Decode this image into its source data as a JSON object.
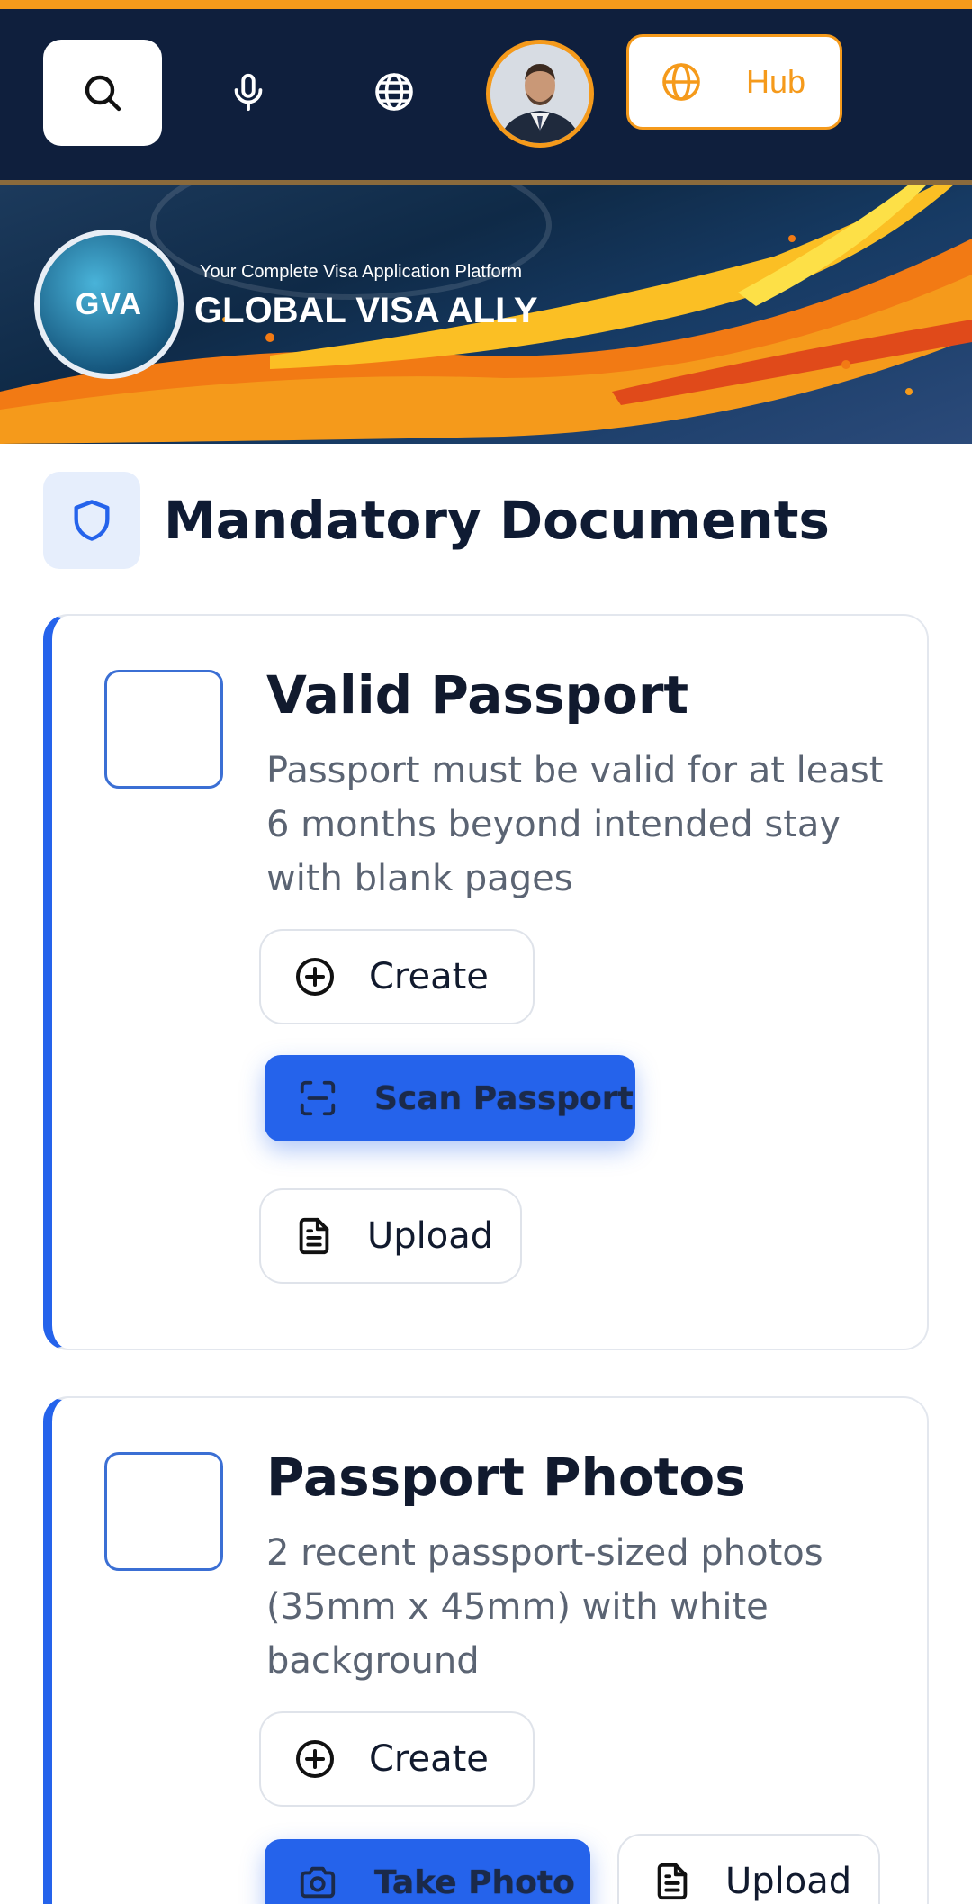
{
  "header": {
    "hub_label": "Hub",
    "accent_color": "#f59a1b",
    "bar_color": "#0f1f3d",
    "icons": [
      "search-icon",
      "microphone-icon",
      "globe-icon",
      "globe-icon"
    ]
  },
  "banner": {
    "logo_text": "GVA",
    "tagline": "Your Complete Visa Application Platform",
    "brand": "GLOBAL VISA ALLY"
  },
  "section": {
    "title": "Mandatory Documents",
    "icon": "shield-icon"
  },
  "documents": [
    {
      "title": "Valid Passport",
      "description": "Passport must be valid for at least 6 months beyond intended stay with blank pages",
      "create_label": "Create",
      "action_label": "Scan Passport",
      "upload_label": "Upload"
    },
    {
      "title": "Passport Photos",
      "description": "2 recent passport-sized photos (35mm x 45mm) with white background",
      "create_label": "Create",
      "action_label": "Take Photo",
      "upload_label": "Upload"
    }
  ],
  "colors": {
    "primary_blue": "#2563eb",
    "text_dark": "#111a2e",
    "text_muted": "#5b6473"
  }
}
